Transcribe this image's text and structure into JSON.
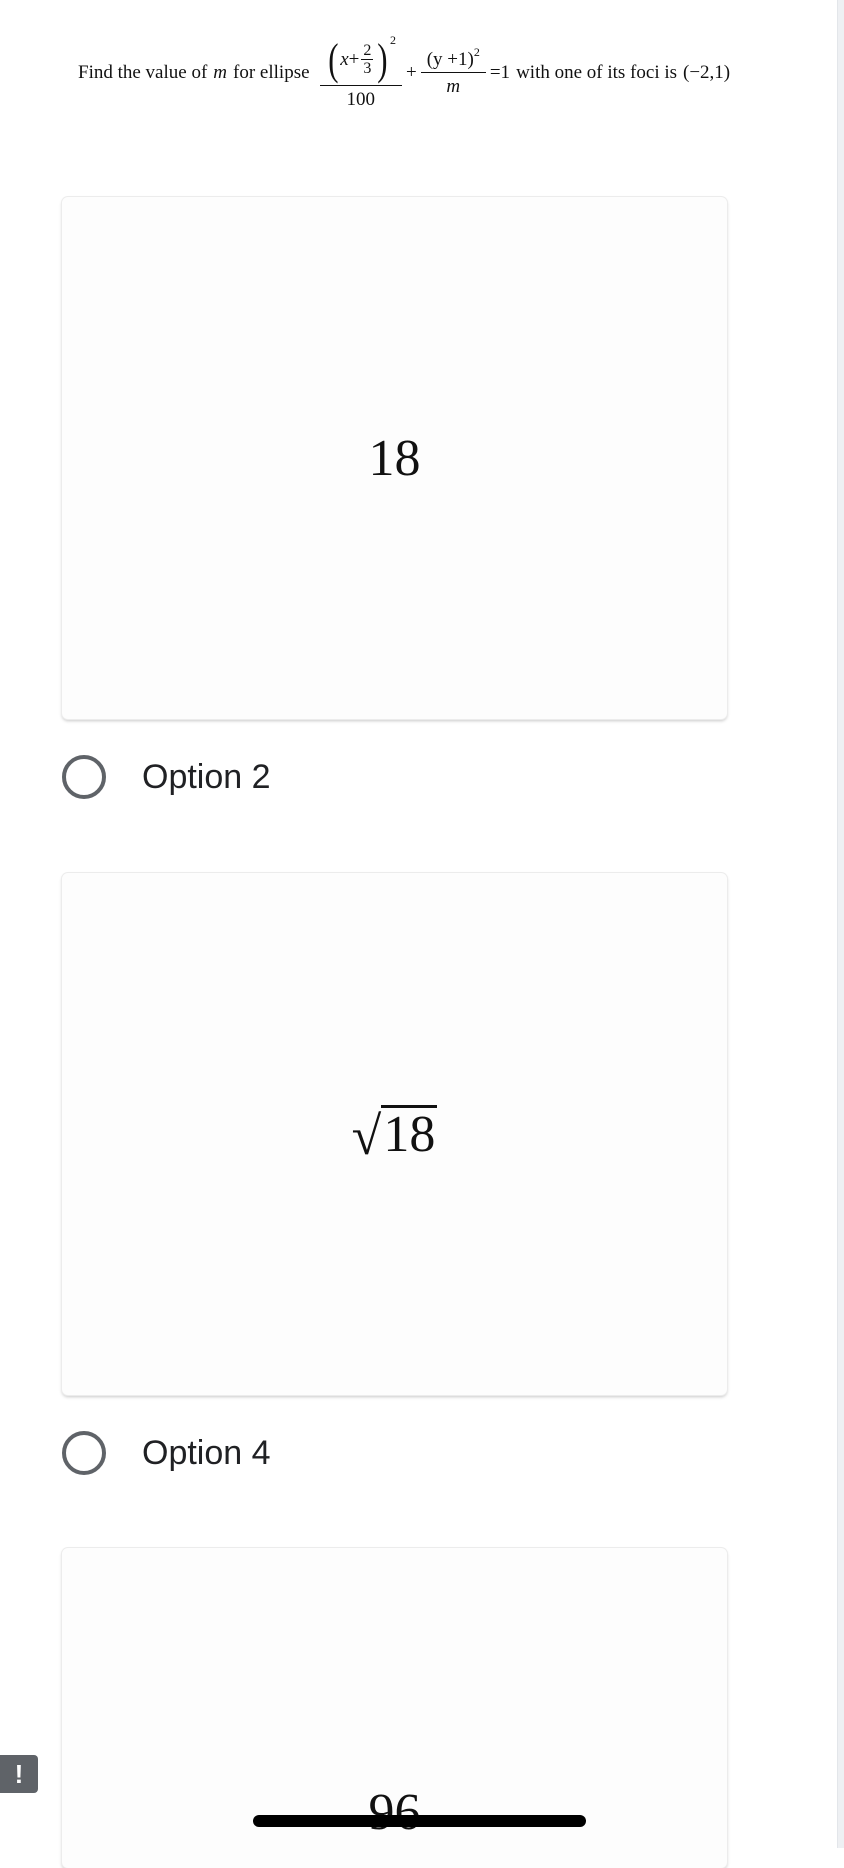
{
  "question": {
    "prefix": "Find the value of",
    "variable": "m",
    "middle": "for ellipse",
    "term1": {
      "x": "x",
      "plus": "+",
      "frac_num": "2",
      "frac_den": "3",
      "exponent": "2",
      "denominator": "100"
    },
    "plus": "+",
    "term2": {
      "numerator": "(y +1)",
      "exponent": "2",
      "denominator": "m"
    },
    "equals": "=1",
    "suffix": "with one of its foci is",
    "focus": "(−2,1)"
  },
  "options": [
    {
      "card_value": "18",
      "label": "Option 2"
    },
    {
      "card_value": "18",
      "is_sqrt": true,
      "label": "Option 4"
    },
    {
      "card_value": "96"
    }
  ],
  "icons": {
    "radio": "radio-unchecked-icon",
    "alert": "exclamation-icon"
  },
  "fab": {
    "label": "!"
  }
}
